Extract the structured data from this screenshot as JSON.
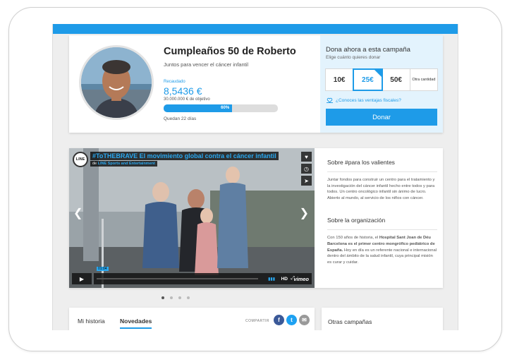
{
  "campaign": {
    "title": "Cumpleaños 50 de Roberto",
    "subtitle": "Juntos para vencer el cáncer infantil",
    "raised_label": "Recaudado",
    "raised_value": "8,5436 €",
    "goal": "30.000.000 € de objetivo",
    "progress_label": "60%",
    "progress": 0.6,
    "days_left": "Quedan 22 días"
  },
  "donate": {
    "title": "Dona ahora a esta campaña",
    "subtitle": "Elige cuánto quieres donar",
    "amounts": [
      "10€",
      "25€",
      "50€"
    ],
    "selected_amount": "25€",
    "other_amount": "Otra cantidad",
    "tax_link": "¿Conoces las ventajas fiscales?",
    "button": "Donar"
  },
  "video": {
    "logo": "LINE",
    "title": "#ToTHEBRAVE El movimiento global contra el cáncer infantil",
    "channel_prefix": "de",
    "channel": "LINE Sports and Entertainment",
    "time": "01:04",
    "hd": "HD",
    "brand": "vimeo",
    "slides": 4,
    "active_slide": 1
  },
  "about": {
    "cause_title": "Sobre #para los valientes",
    "cause_text": "Juntar fondos para construir un centro para el tratamiento y la investigación del cáncer infantil hecho entre todos y para todos. Un centro oncológico infantil sin ánimo de lucro. Abierto al mundo, al servicio de los niños con cáncer.",
    "org_title": "Sobre la organización",
    "org_text_1": "Con 150 años de historia, el",
    "org_text_bold": "Hospital Sant Joan de Déu Barcelona es el primer centro mongrófico pediátrico de España.",
    "org_text_2": "Hoy en día es un referente nacional e internacional dentro del ámbito de la salud infantil, cuya principal misión es curar y cuidar."
  },
  "tabs": {
    "history": "Mi historia",
    "news": "Novedades",
    "share": "COMPARTIR"
  },
  "other": {
    "title": "Otras campañas"
  },
  "colors": {
    "primary": "#1e9be8",
    "donate_bg": "#e3f3fd",
    "facebook": "#3b5998",
    "twitter": "#1da1f2",
    "mail": "#999999"
  }
}
